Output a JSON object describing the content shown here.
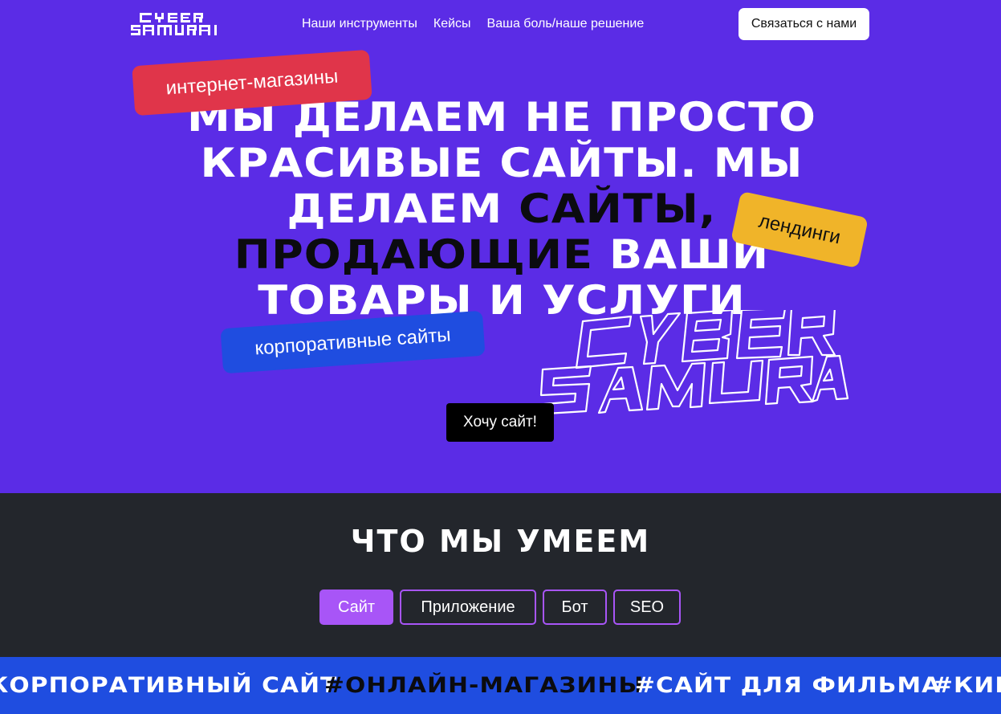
{
  "header": {
    "logo_text": "CYBER SAMURAI",
    "nav": [
      {
        "label": "Наши инструменты"
      },
      {
        "label": "Кейсы"
      },
      {
        "label": "Ваша боль/наше решение"
      }
    ],
    "contact_label": "Связаться с нами"
  },
  "hero": {
    "line1": "МЫ ДЕЛАЕМ НЕ ПРОСТО",
    "line2": "КРАСИВЫЕ САЙТЫ. МЫ",
    "line3a": "ДЕЛАЕМ ",
    "line3b": "САЙТЫ,",
    "line4a": "ПРОДАЮЩИЕ ",
    "line4b": "ВАШИ",
    "line5": "ТОВАРЫ И УСЛУГИ",
    "tags": {
      "red": "интернет-магазины",
      "yellow": "лендинги",
      "blue": "корпоративные сайты"
    },
    "cta_label": "Хочу сайт!"
  },
  "skills": {
    "title": "ЧТО МЫ УМЕЕМ",
    "tabs": [
      {
        "label": "Сайт"
      },
      {
        "label": "Приложение"
      },
      {
        "label": "Бот"
      },
      {
        "label": "SEO"
      }
    ]
  },
  "ticker": {
    "items": [
      "#КОРПОРАТИВНЫЙ САЙТ",
      "#ОНЛАЙН-МАГАЗИНЫ",
      "#САЙТ ДЛЯ ФИЛЬМА",
      "#КИНО"
    ]
  },
  "colors": {
    "hero_bg": "#5b2ce6",
    "skills_bg": "#23262c",
    "accent_purple": "#a855f7",
    "ticker_bg": "#1f4de0",
    "tag_red": "#e0354a",
    "tag_yellow": "#f0b429",
    "tag_blue": "#1f4de0"
  }
}
